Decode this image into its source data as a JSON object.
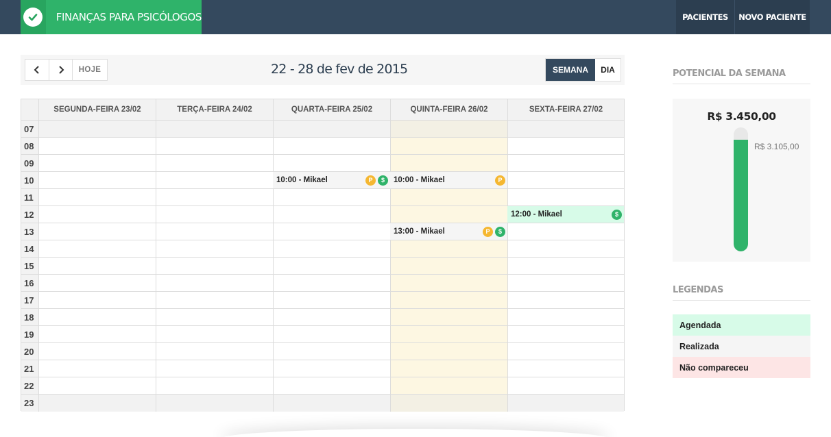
{
  "header": {
    "brand_title": "FINANÇAS PARA PSICÓLOGOS",
    "brand_icon": "check-icon",
    "nav": [
      {
        "label": "PACIENTES"
      },
      {
        "label": "NOVO PACIENTE"
      }
    ]
  },
  "toolbar": {
    "prev_icon": "chevron-left-icon",
    "next_icon": "chevron-right-icon",
    "today_label": "HOJE",
    "range_title": "22 - 28 de fev de 2015",
    "views": [
      {
        "label": "SEMANA",
        "active": true
      },
      {
        "label": "DIA",
        "active": false
      }
    ]
  },
  "calendar": {
    "days": [
      {
        "label": "SEGUNDA-FEIRA 23/02",
        "today": false
      },
      {
        "label": "TERÇA-FEIRA 24/02",
        "today": false
      },
      {
        "label": "QUARTA-FEIRA 25/02",
        "today": false
      },
      {
        "label": "QUINTA-FEIRA 26/02",
        "today": true
      },
      {
        "label": "SEXTA-FEIRA 27/02",
        "today": false
      }
    ],
    "hours": [
      "07",
      "08",
      "09",
      "10",
      "11",
      "12",
      "13",
      "14",
      "15",
      "16",
      "17",
      "18",
      "19",
      "20",
      "21",
      "22",
      "23"
    ],
    "events": [
      {
        "day": 2,
        "hour": "10",
        "text": "10:00 - Mikael",
        "status": "realizada",
        "badges": [
          "P",
          "$"
        ]
      },
      {
        "day": 3,
        "hour": "10",
        "text": "10:00 - Mikael",
        "status": "realizada",
        "badges": [
          "P"
        ]
      },
      {
        "day": 4,
        "hour": "12",
        "text": "12:00 - Mikael",
        "status": "agendada",
        "badges": [
          "$"
        ]
      },
      {
        "day": 3,
        "hour": "13",
        "text": "13:00 - Mikael",
        "status": "realizada",
        "badges": [
          "P",
          "$"
        ]
      }
    ]
  },
  "sidebar": {
    "potential_title": "POTENCIAL DA SEMANA",
    "potential_total": "R$ 3.450,00",
    "potential_value": "R$ 3.105,00",
    "potential_fraction": 0.9,
    "legend_title": "LEGENDAS",
    "legend": [
      {
        "label": "Agendada",
        "status": "agendada"
      },
      {
        "label": "Realizada",
        "status": "realizada"
      },
      {
        "label": "Não compareceu",
        "status": "nao"
      }
    ]
  },
  "colors": {
    "topbar": "#34495e",
    "brand": "#2fb36a",
    "today_column": "#fdf7e2",
    "agendada": "#d7fbe8",
    "realizada": "#f5f5f5",
    "nao_compareceu": "#fde5e5",
    "badge_p": "#f5b731",
    "badge_dollar": "#2fb36a"
  }
}
